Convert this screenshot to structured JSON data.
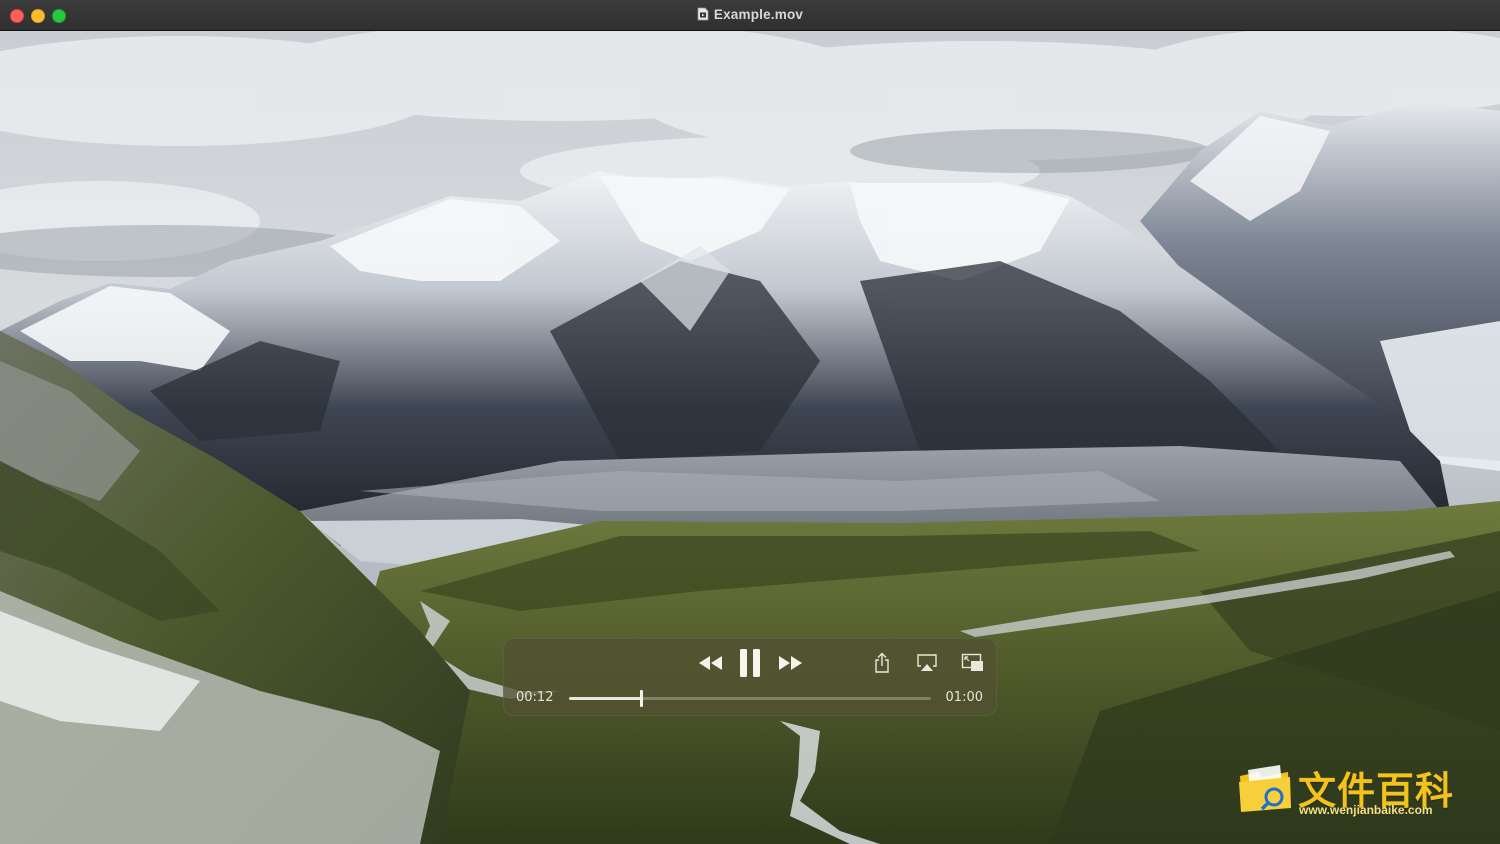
{
  "window": {
    "title": "Example.mov"
  },
  "player": {
    "current_time": "00:12",
    "duration": "01:00",
    "progress": 0.2,
    "state": "playing"
  },
  "watermark": {
    "text": "文件百科",
    "url": "www.wenjianbaike.com"
  },
  "colors": {
    "close": "#ff5f57",
    "minimize": "#febc2e",
    "zoom": "#28c840",
    "watermark": "#f5c21c"
  }
}
